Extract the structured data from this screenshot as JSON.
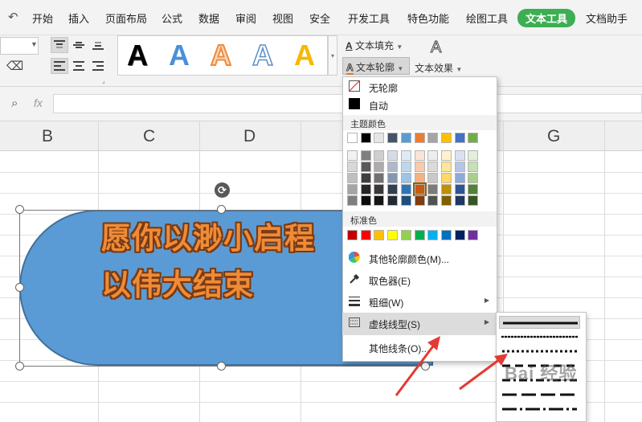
{
  "tabs": [
    {
      "label": "开始"
    },
    {
      "label": "插入"
    },
    {
      "label": "页面布局"
    },
    {
      "label": "公式"
    },
    {
      "label": "数据"
    },
    {
      "label": "审阅"
    },
    {
      "label": "视图"
    },
    {
      "label": "安全"
    },
    {
      "label": "开发工具"
    },
    {
      "label": "特色功能"
    },
    {
      "label": "绘图工具"
    },
    {
      "label": "文本工具",
      "active": true
    },
    {
      "label": "文档助手"
    }
  ],
  "ribbon": {
    "text_fill_label": "文本填充",
    "text_outline_label": "文本轮廓",
    "text_effect_label": "文本效果",
    "wordart_glyph": "A",
    "wordart_styles": [
      {
        "name": "black-fill",
        "color": "#000000"
      },
      {
        "name": "blue-gradient",
        "color": "#4a90d9"
      },
      {
        "name": "orange-outline",
        "color": "#f08a3c"
      },
      {
        "name": "blue-outline",
        "color": "#ffffff"
      },
      {
        "name": "gold-fill",
        "color": "#f5b800"
      }
    ]
  },
  "formula_bar": {
    "fx": "fx",
    "value": ""
  },
  "columns": [
    "B",
    "C",
    "D",
    "G"
  ],
  "shape": {
    "fill": "#5b9bd5",
    "lines": [
      "愿你以渺小启程",
      "以伟大结束"
    ]
  },
  "outline_menu": {
    "no_outline": "无轮廓",
    "automatic": "自动",
    "theme_colors_title": "主题颜色",
    "theme_colors_top": [
      "#ffffff",
      "#000000",
      "#e7e6e6",
      "#44546a",
      "#5b9bd5",
      "#ed7d31",
      "#a5a5a5",
      "#ffc000",
      "#4472c4",
      "#70ad47"
    ],
    "theme_colors_shades": [
      [
        "#f2f2f2",
        "#7f7f7f",
        "#d0cece",
        "#d6dce4",
        "#deebf6",
        "#fbe4d5",
        "#ededed",
        "#fff2cc",
        "#d9e2f3",
        "#e2efd9"
      ],
      [
        "#d8d8d8",
        "#595959",
        "#aeabab",
        "#adb9ca",
        "#bdd7ee",
        "#f7cbac",
        "#dbdbdb",
        "#ffe599",
        "#b4c6e7",
        "#c5e0b3"
      ],
      [
        "#bfbfbf",
        "#3f3f3f",
        "#757070",
        "#8496b0",
        "#9dc3e6",
        "#f4b183",
        "#c9c9c9",
        "#ffd966",
        "#8eaadb",
        "#a8d08d"
      ],
      [
        "#a5a5a5",
        "#262626",
        "#3a3838",
        "#323f4f",
        "#2e75b5",
        "#c55a11",
        "#7b7b7b",
        "#bf9000",
        "#2f5496",
        "#538135"
      ],
      [
        "#7f7f7f",
        "#0c0c0c",
        "#171616",
        "#222a35",
        "#1e4e79",
        "#833c0b",
        "#525252",
        "#7f6000",
        "#1f3864",
        "#375623"
      ]
    ],
    "selected_swatch": {
      "row": 3,
      "col": 5
    },
    "standard_colors_title": "标准色",
    "standard_colors": [
      "#c00000",
      "#ff0000",
      "#ffc000",
      "#ffff00",
      "#92d050",
      "#00b050",
      "#00b0f0",
      "#0070c0",
      "#002060",
      "#7030a0"
    ],
    "more_colors": "其他轮廓颜色(M)...",
    "eyedropper": "取色器(E)",
    "weight": "粗细(W)",
    "dash": "虚线线型(S)",
    "more_lines": "其他线条(O)..."
  },
  "dash_submenu": {
    "styles": [
      "solid",
      "round-dot",
      "square-dot",
      "dash",
      "dash-dot",
      "long-dash",
      "long-dash-dot"
    ]
  },
  "watermark": "Bai 经验"
}
